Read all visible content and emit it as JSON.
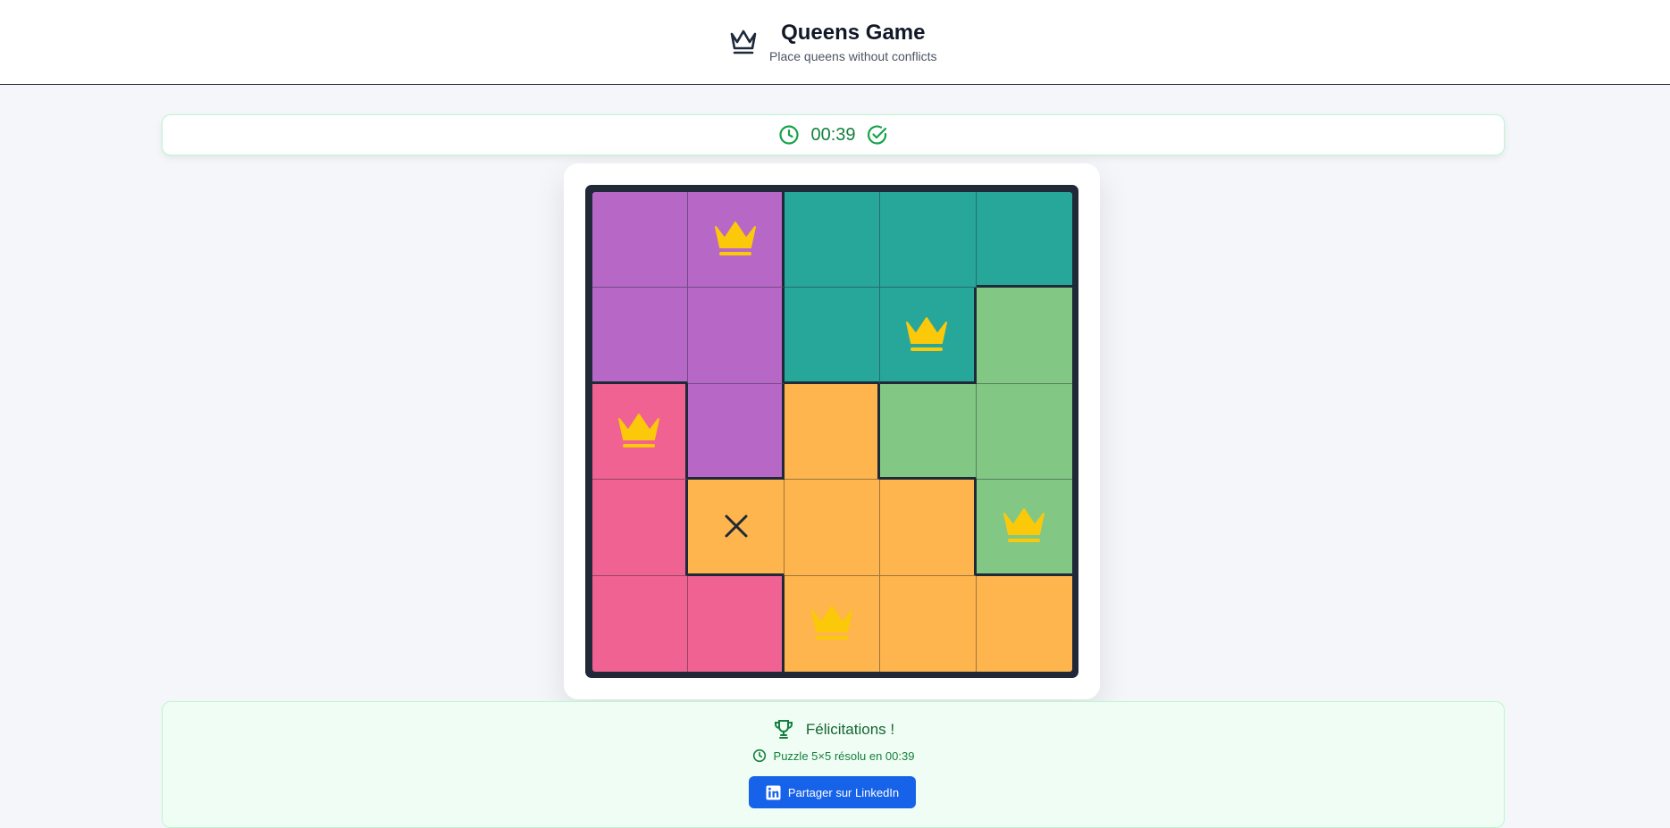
{
  "header": {
    "title": "Queens Game",
    "subtitle": "Place queens without conflicts",
    "icon": "crown-icon"
  },
  "timer": {
    "value": "00:39",
    "icon": "clock-icon",
    "status_icon": "check-circle-icon"
  },
  "colors": {
    "purple": "#b768c6",
    "teal": "#27a69a",
    "green": "#82c784",
    "pink": "#f06292",
    "orange": "#ffb54d",
    "queen": "#fcc80a",
    "success": "#15803d",
    "linkedin_button": "#1662e8"
  },
  "board": {
    "size": 5,
    "regions": [
      [
        "purple",
        "purple",
        "teal",
        "teal",
        "teal"
      ],
      [
        "purple",
        "purple",
        "teal",
        "teal",
        "green"
      ],
      [
        "pink",
        "purple",
        "orange",
        "green",
        "green"
      ],
      [
        "pink",
        "orange",
        "orange",
        "orange",
        "green"
      ],
      [
        "pink",
        "pink",
        "orange",
        "orange",
        "orange"
      ]
    ],
    "marks": [
      [
        "",
        "queen",
        "",
        "",
        ""
      ],
      [
        "",
        "",
        "",
        "queen",
        ""
      ],
      [
        "queen",
        "",
        "",
        "",
        ""
      ],
      [
        "",
        "x",
        "",
        "",
        "queen"
      ],
      [
        "",
        "",
        "queen",
        "",
        ""
      ]
    ]
  },
  "success": {
    "title": "Félicitations !",
    "message": "Puzzle 5×5 résolu en 00:39",
    "share_label": "Partager sur LinkedIn",
    "trophy_icon": "trophy-icon",
    "clock_icon": "clock-icon",
    "share_icon": "linkedin-icon"
  }
}
